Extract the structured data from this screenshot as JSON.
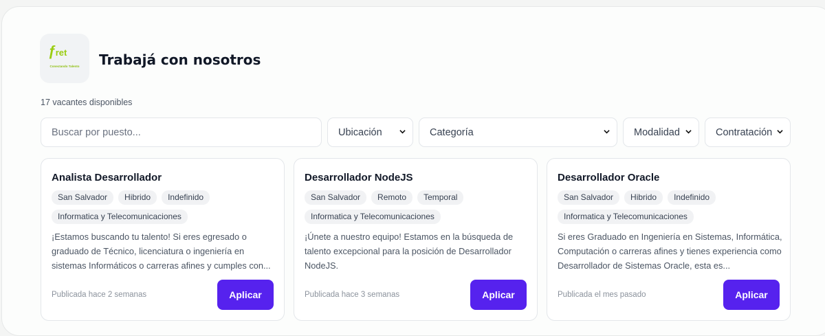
{
  "header": {
    "logo_text": "ret",
    "logo_tagline": "Conectando Talento",
    "title": "Trabajá con nosotros",
    "vacancy_count": "17 vacantes disponibles"
  },
  "filters": {
    "search_placeholder": "Buscar por puesto...",
    "location": "Ubicación",
    "category": "Categoría",
    "modality": "Modalidad",
    "contract": "Contratación"
  },
  "jobs": [
    {
      "title": "Analista Desarrollador",
      "tags": [
        "San Salvador",
        "Hibrido",
        "Indefinido",
        "Informatica y Telecomunicaciones"
      ],
      "description": "¡Estamos buscando tu talento! Si eres egresado o graduado de Técnico, licenciatura o ingeniería en sistemas Informáticos o carreras afines y cumples con...",
      "posted": "Publicada hace 2 semanas",
      "apply": "Aplicar"
    },
    {
      "title": "Desarrollador NodeJS",
      "tags": [
        "San Salvador",
        "Remoto",
        "Temporal",
        "Informatica y Telecomunicaciones"
      ],
      "description": "¡Únete a nuestro equipo! Estamos en la búsqueda de talento excepcional para la posición de Desarrollador NodeJS.",
      "posted": "Publicada hace 3 semanas",
      "apply": "Aplicar"
    },
    {
      "title": "Desarrollador Oracle",
      "tags": [
        "San Salvador",
        "Hibrido",
        "Indefinido",
        "Informatica y Telecomunicaciones"
      ],
      "description": "Si eres Graduado en Ingeniería en Sistemas, Informática, Computación o carreras afines y tienes experiencia como Desarrollador de Sistemas Oracle, esta es...",
      "posted": "Publicada el mes pasado",
      "apply": "Aplicar"
    }
  ],
  "colors": {
    "accent": "#5622ee",
    "logo": "#9acd12"
  }
}
